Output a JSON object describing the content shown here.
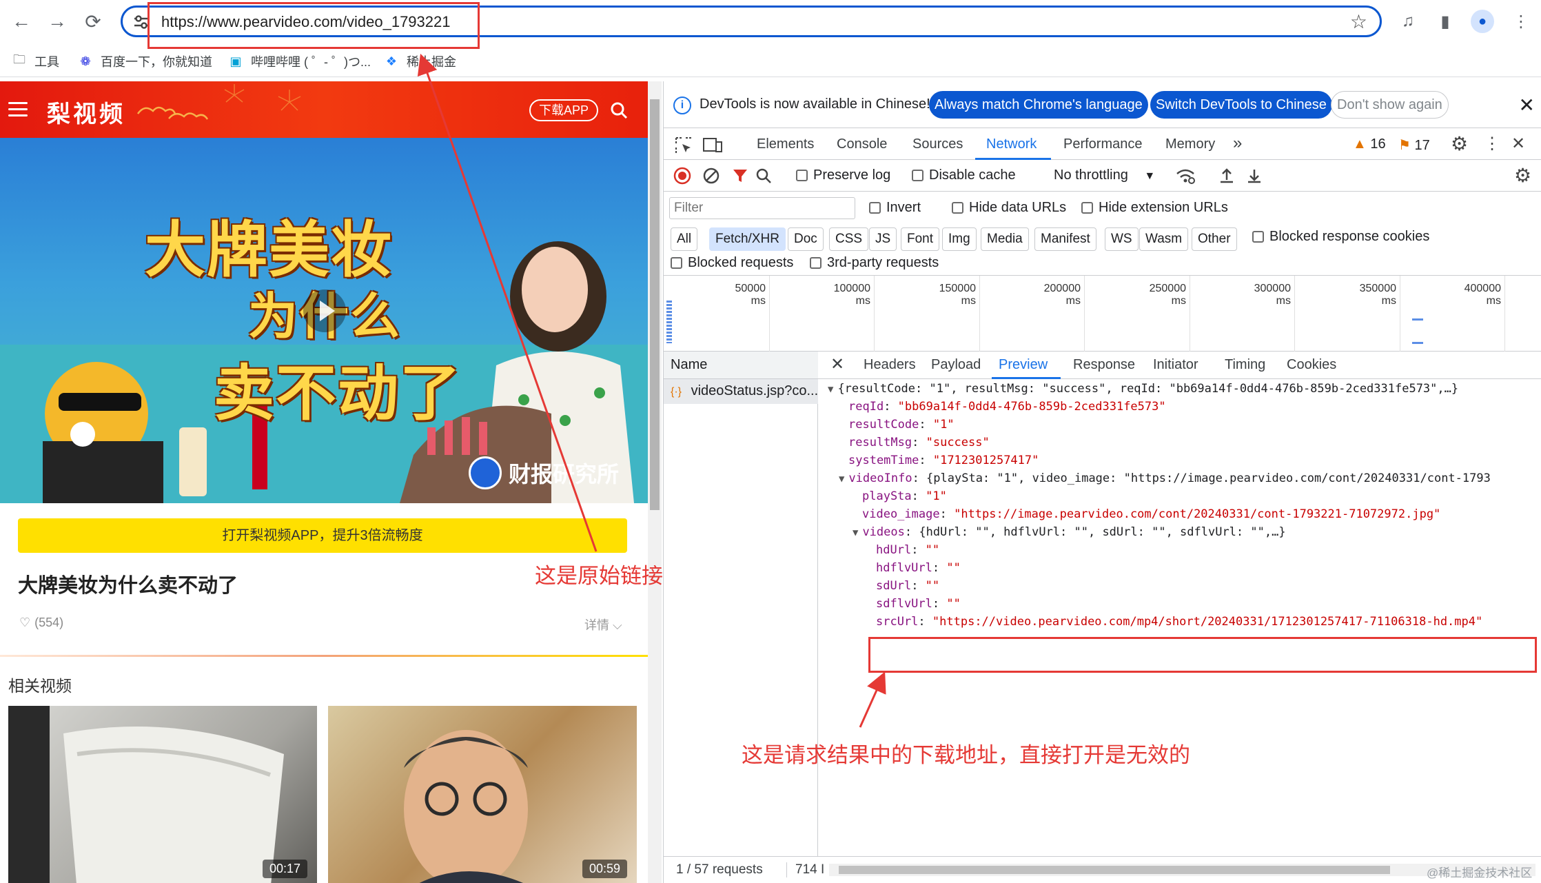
{
  "browser": {
    "url": "https://www.pearvideo.com/video_1793221",
    "bookmarks": [
      "工具",
      "百度一下，你就知道",
      "哔哩哔哩 ( ゜- ゜)つ...",
      "稀土掘金"
    ]
  },
  "page": {
    "logo": "梨视频",
    "download_app": "下载APP",
    "video_headline": [
      "大牌美妆",
      "为什么",
      "卖不动了"
    ],
    "brand_badge": "财报研究所",
    "app_banner": "打开梨视频APP，提升3倍流畅度",
    "title": "大牌美妆为什么卖不动了",
    "likes": "(554)",
    "details": "详情",
    "related_title": "相关视频",
    "related": [
      {
        "duration": "00:17"
      },
      {
        "duration": "00:59"
      }
    ]
  },
  "annotations": {
    "original_link": "这是原始链接",
    "download_note": "这是请求结果中的下载地址，直接打开是无效的"
  },
  "devtools": {
    "info_message": "DevTools is now available in Chinese!",
    "btn_match": "Always match Chrome's language",
    "btn_switch": "Switch DevTools to Chinese",
    "btn_dont_show": "Don't show again",
    "tabs": [
      "Elements",
      "Console",
      "Sources",
      "Network",
      "Performance",
      "Memory"
    ],
    "active_tab": "Network",
    "warnings": "16",
    "issues": "17",
    "toolbar": {
      "preserve_log": "Preserve log",
      "disable_cache": "Disable cache",
      "throttling": "No throttling"
    },
    "filter": {
      "placeholder": "Filter",
      "invert": "Invert",
      "hide_data": "Hide data URLs",
      "hide_ext": "Hide extension URLs"
    },
    "types": [
      "All",
      "Fetch/XHR",
      "Doc",
      "CSS",
      "JS",
      "Font",
      "Img",
      "Media",
      "Manifest",
      "WS",
      "Wasm",
      "Other"
    ],
    "active_type": "Fetch/XHR",
    "blocked_cookies": "Blocked response cookies",
    "blocked_requests": "Blocked requests",
    "third_party": "3rd-party requests",
    "timeline_ticks": [
      "50000 ms",
      "100000 ms",
      "150000 ms",
      "200000 ms",
      "250000 ms",
      "300000 ms",
      "350000 ms",
      "400000 ms"
    ],
    "name_header": "Name",
    "request_name": "videoStatus.jsp?co...",
    "detail_tabs": [
      "Headers",
      "Payload",
      "Preview",
      "Response",
      "Initiator",
      "Timing",
      "Cookies"
    ],
    "active_detail": "Preview",
    "preview": {
      "root_summary": "{resultCode: \"1\", resultMsg: \"success\", reqId: \"bb69a14f-0dd4-476b-859b-2ced331fe573\",…}",
      "reqId_key": "reqId",
      "reqId_val": "\"bb69a14f-0dd4-476b-859b-2ced331fe573\"",
      "resultCode_key": "resultCode",
      "resultCode_val": "\"1\"",
      "resultMsg_key": "resultMsg",
      "resultMsg_val": "\"success\"",
      "systemTime_key": "systemTime",
      "systemTime_val": "\"1712301257417\"",
      "videoInfo_key": "videoInfo",
      "videoInfo_summary": "{playSta: \"1\", video_image: \"https://image.pearvideo.com/cont/20240331/cont-1793",
      "playSta_key": "playSta",
      "playSta_val": "\"1\"",
      "video_image_key": "video_image",
      "video_image_val": "\"https://image.pearvideo.com/cont/20240331/cont-1793221-71072972.jpg\"",
      "videos_key": "videos",
      "videos_summary": "{hdUrl: \"\", hdflvUrl: \"\", sdUrl: \"\", sdflvUrl: \"\",…}",
      "hdUrl_key": "hdUrl",
      "hdflvUrl_key": "hdflvUrl",
      "sdUrl_key": "sdUrl",
      "sdflvUrl_key": "sdflvUrl",
      "empty_val": "\"\"",
      "srcUrl_key": "srcUrl",
      "srcUrl_val": "\"https://video.pearvideo.com/mp4/short/20240331/1712301257417-71106318-hd.mp4\""
    },
    "status_requests": "1 / 57 requests",
    "status_size": "714 I"
  },
  "watermark": "@稀土掘金技术社区"
}
